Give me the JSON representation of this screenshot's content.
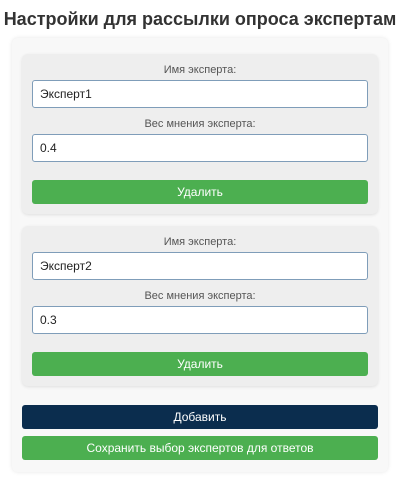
{
  "page": {
    "title": "Настройки для рассылки опроса экспертам"
  },
  "experts": [
    {
      "name_label": "Имя эксперта:",
      "name_value": "Эксперт1",
      "weight_label": "Вес мнения эксперта:",
      "weight_value": "0.4",
      "delete_label": "Удалить"
    },
    {
      "name_label": "Имя эксперта:",
      "name_value": "Эксперт2",
      "weight_label": "Вес мнения эксперта:",
      "weight_value": "0.3",
      "delete_label": "Удалить"
    }
  ],
  "actions": {
    "add_label": "Добавить",
    "save_label": "Сохранить выбор экспертов для ответов"
  },
  "colors": {
    "primary_green": "#4caf50",
    "add_navy": "#0b2d4e",
    "card_bg": "#eeeeee",
    "container_bg": "#f8f8f8"
  }
}
